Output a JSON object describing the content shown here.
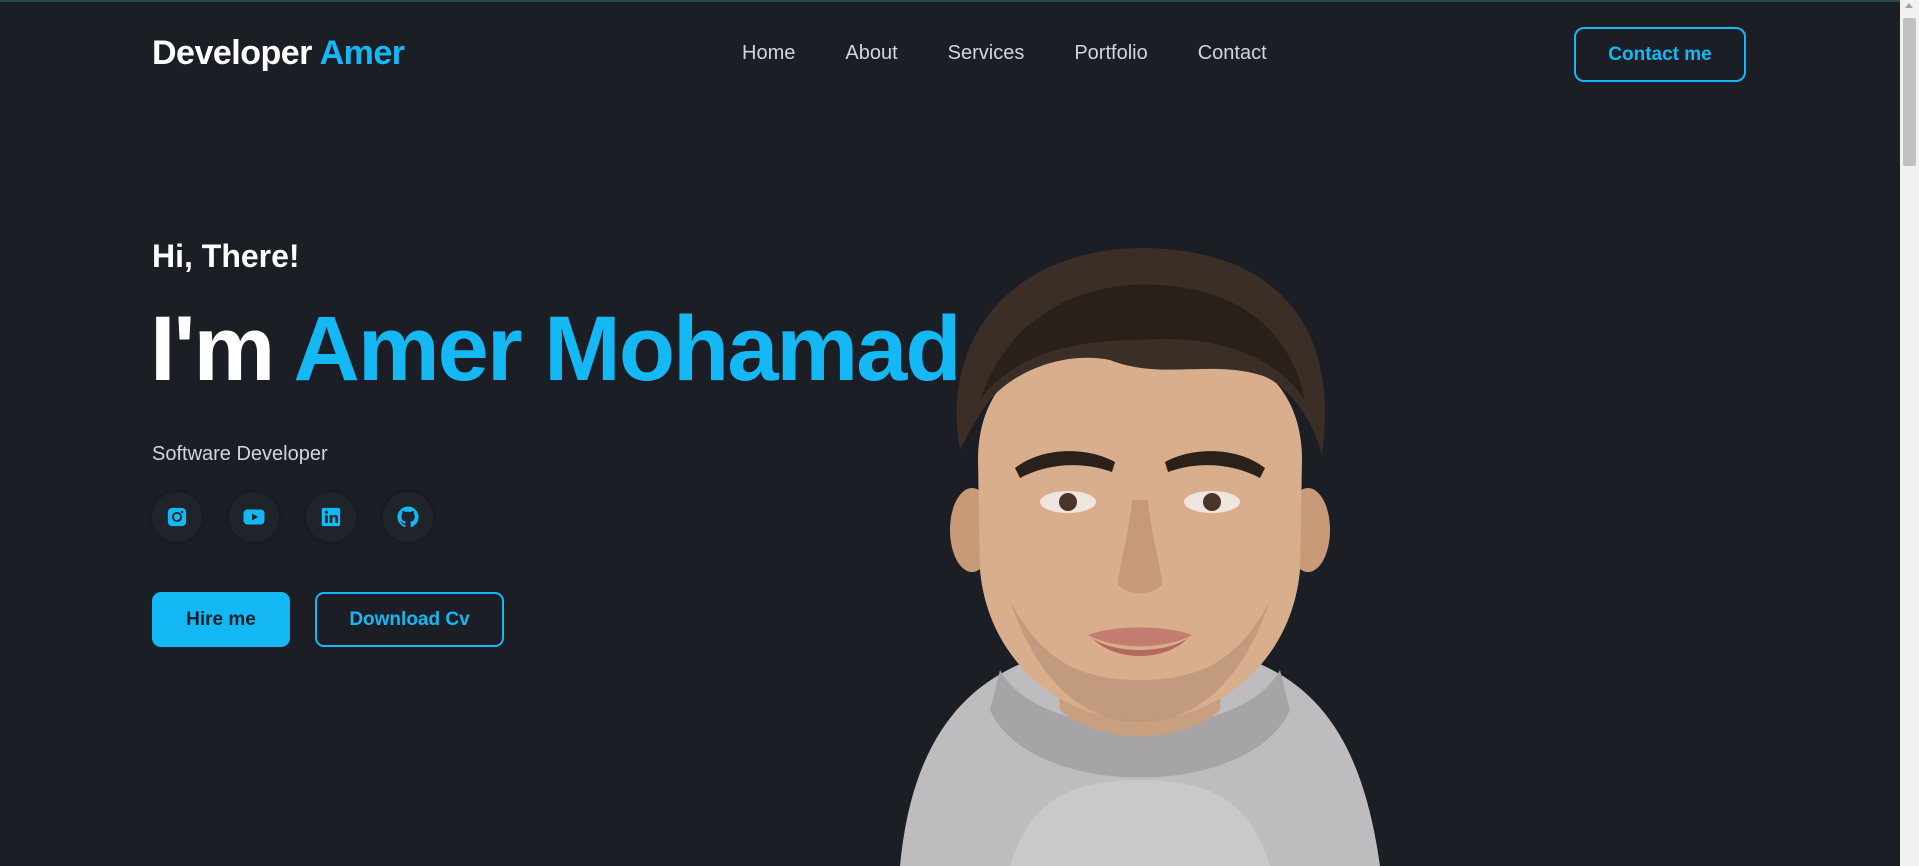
{
  "header": {
    "logo_text": "Developer",
    "logo_accent": "Amer",
    "nav": [
      "Home",
      "About",
      "Services",
      "Portfolio",
      "Contact"
    ],
    "contact_button": "Contact me"
  },
  "hero": {
    "greeting": "Hi, There!",
    "title_prefix": "I'm",
    "title_name": "Amer Mohamad",
    "role": "Software Developer",
    "socials": [
      "instagram-icon",
      "youtube-icon",
      "linkedin-icon",
      "github-icon"
    ],
    "hire_button": "Hire me",
    "cv_button": "Download Cv"
  },
  "colors": {
    "background": "#1b1e24",
    "accent": "#14b8f5",
    "text": "#ffffff",
    "muted_text": "#d2d6dc"
  }
}
